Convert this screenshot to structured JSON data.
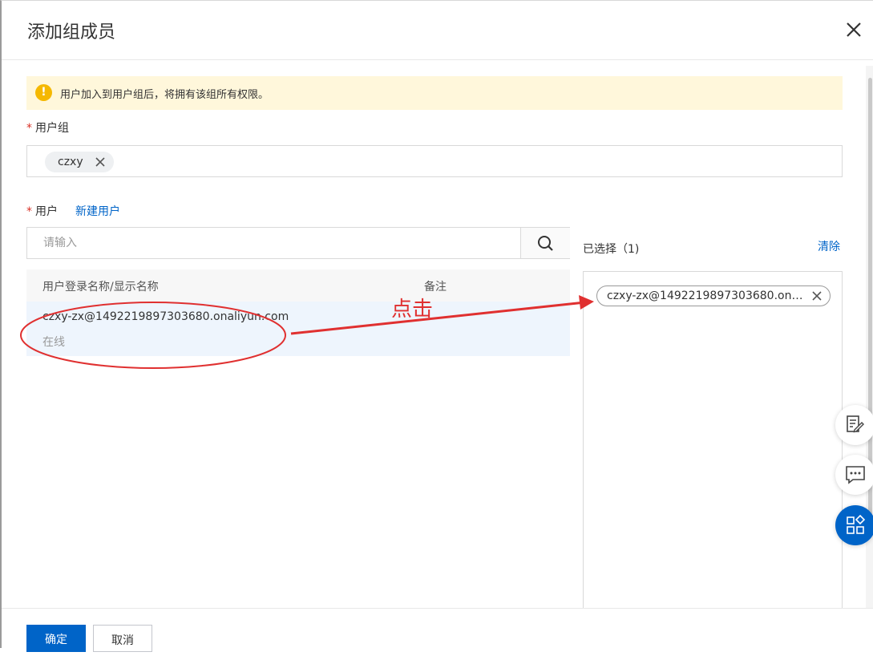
{
  "dialog": {
    "title": "添加组成员"
  },
  "alert": {
    "text": "用户加入到用户组后，将拥有该组所有权限。"
  },
  "group_field": {
    "required_mark": "*",
    "label": "用户组",
    "tags": [
      "czxy"
    ]
  },
  "user_field": {
    "required_mark": "*",
    "label": "用户",
    "new_user_link": "新建用户"
  },
  "search": {
    "placeholder": "请输入",
    "value": ""
  },
  "table": {
    "columns": [
      "用户登录名称/显示名称",
      "备注"
    ],
    "rows": [
      {
        "name": "czxy-zx@1492219897303680.onaliyun.com",
        "status": "在线",
        "remark": ""
      }
    ]
  },
  "selected": {
    "title": "已选择（1)",
    "clear_label": "清除",
    "items": [
      "czxy-zx@1492219897303680.onaliyun.com"
    ]
  },
  "annotation": {
    "text": "点击",
    "color": "#e03030"
  },
  "float_buttons": [
    "edit-note-icon",
    "chat-icon",
    "apps-icon"
  ],
  "footer": {
    "confirm_label": "确定",
    "cancel_label": "取消"
  },
  "colors": {
    "primary": "#0064c8",
    "alert_bg": "#fff7db",
    "alert_icon": "#f5b800",
    "required": "#d93026",
    "selected_row_bg": "#eef5fd"
  }
}
